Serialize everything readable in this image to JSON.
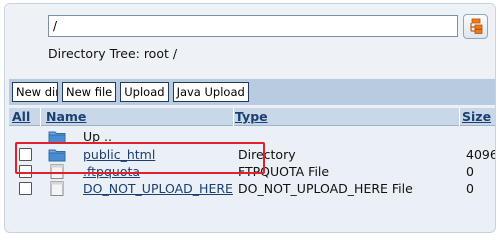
{
  "path": {
    "value": "/"
  },
  "tree": {
    "caption": "Directory Tree: root /",
    "button_icon": "directory-tree-icon"
  },
  "toolbar": {
    "new_dir": "New dir",
    "new_file": "New file",
    "upload": "Upload",
    "java_upload": "Java Upload"
  },
  "table": {
    "headers": {
      "all": "All",
      "name": "Name",
      "type": "Type",
      "size": "Size"
    },
    "up": {
      "label": "Up ..",
      "icon": "folder-icon"
    },
    "rows": [
      {
        "name": "public_html",
        "type": "Directory",
        "size": "4096",
        "icon": "folder-icon"
      },
      {
        "name": ".ftpquota",
        "type": "FTPQUOTA File",
        "size": "0",
        "icon": "file-icon"
      },
      {
        "name": "DO_NOT_UPLOAD_HERE",
        "type": "DO_NOT_UPLOAD_HERE File",
        "size": "0",
        "icon": "file-icon"
      }
    ]
  },
  "colors": {
    "header_bg": "#c9d8e8",
    "toolbar_bg": "#b9cbe0",
    "link": "#1a3f70",
    "highlight": "#e0202a"
  }
}
